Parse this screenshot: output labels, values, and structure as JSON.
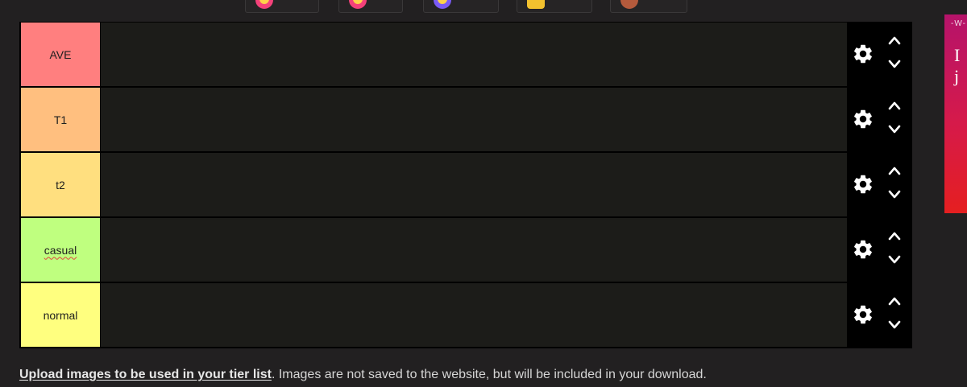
{
  "chips": [
    {
      "count": "",
      "color": "#f4417a"
    },
    {
      "count": "",
      "color": "#f4417a"
    },
    {
      "count": "",
      "color": "#7a5af5"
    },
    {
      "count": "",
      "color": "#f2c12e"
    },
    {
      "count": "",
      "color": "#b45a3c"
    }
  ],
  "tiers": [
    {
      "label": "AVE",
      "color": "#ff7f7f"
    },
    {
      "label": "T1",
      "color": "#ffbf7f"
    },
    {
      "label": "t2",
      "color": "#ffdf7f"
    },
    {
      "label": "casual",
      "color": "#bfff7f"
    },
    {
      "label": "normal",
      "color": "#ffff7f"
    }
  ],
  "footer": {
    "bold": "Upload images to be used in your tier list",
    "rest": ". Images are not saved to the website, but will be included in your download."
  },
  "ad": {
    "tag": "-W-",
    "mark": "I j"
  },
  "icons": {
    "settings": "gear-icon",
    "move_up": "chevron-up-icon",
    "move_down": "chevron-down-icon"
  }
}
